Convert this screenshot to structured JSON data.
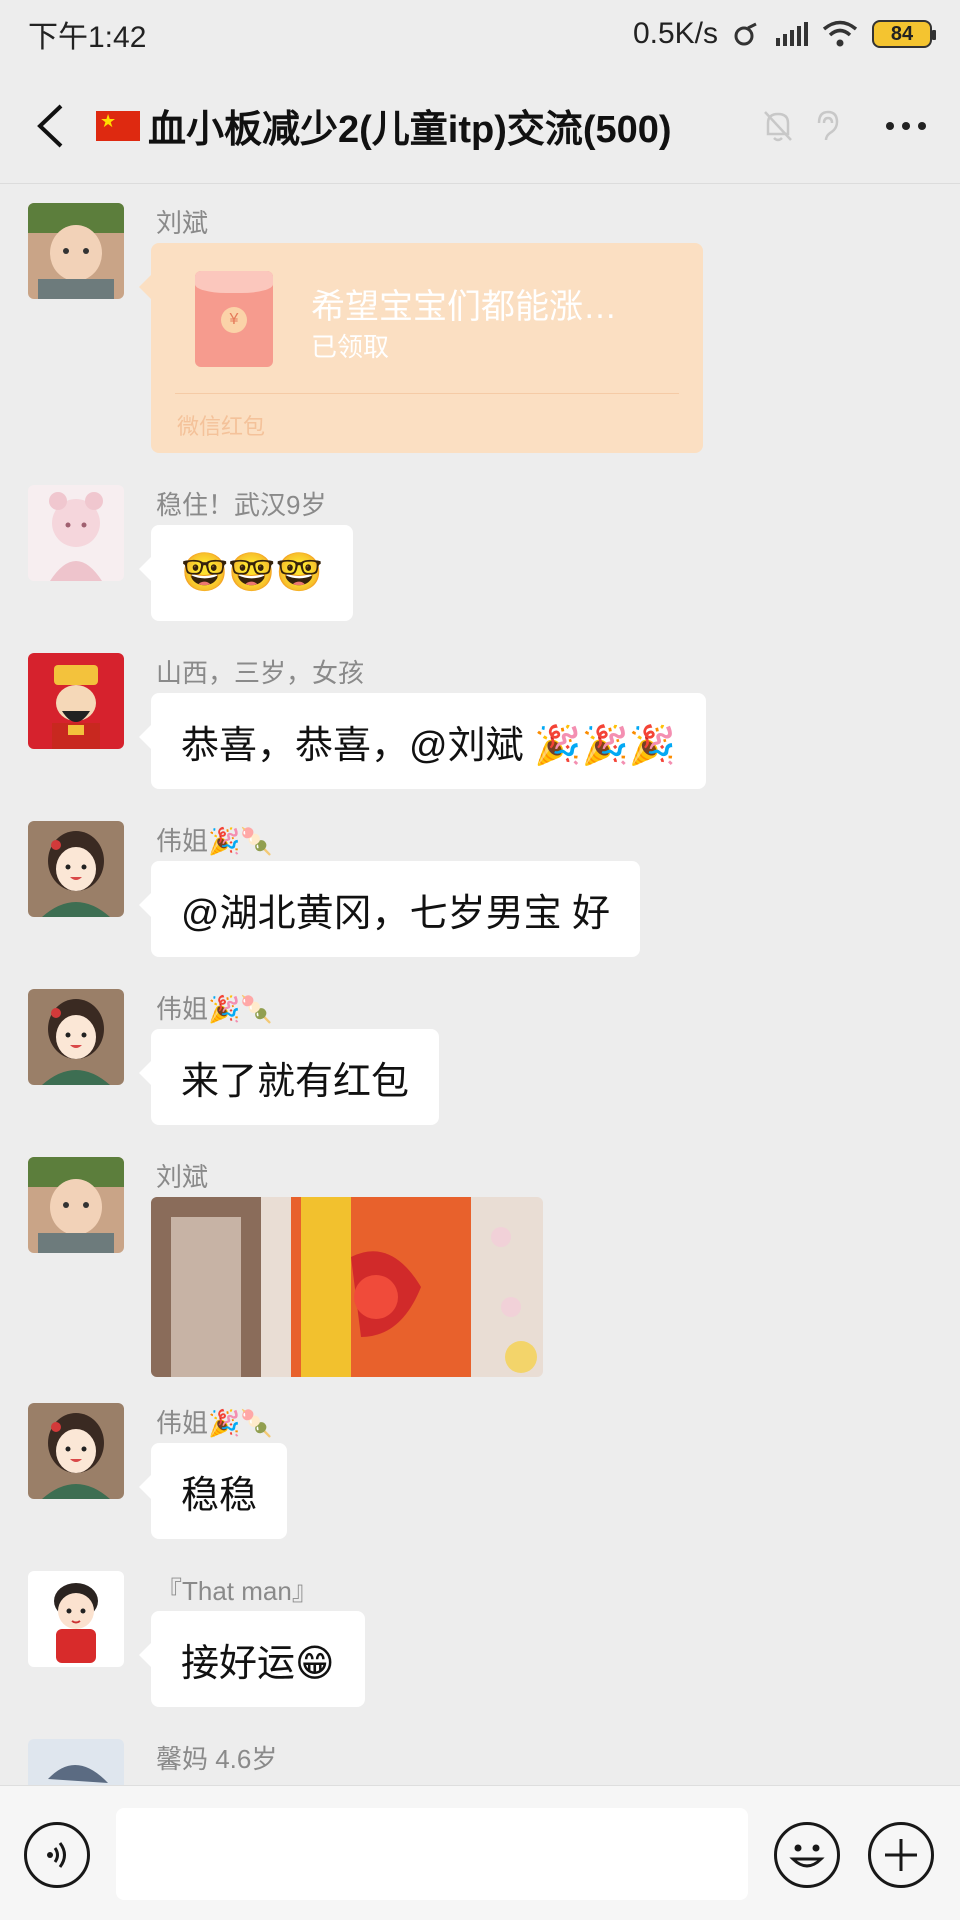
{
  "status_bar": {
    "time": "下午1:42",
    "network_speed": "0.5K/s",
    "battery": "84"
  },
  "header": {
    "title": "血小板减少2(儿童itp)交流(500)",
    "flag_icon": "china-flag-icon",
    "icons": [
      "mute-bell-icon",
      "ear-icon",
      "more-icon"
    ]
  },
  "messages": [
    {
      "sender": "刘斌",
      "type": "red_packet",
      "red_packet": {
        "title": "希望宝宝们都能涨…",
        "status": "已领取",
        "label": "微信红包",
        "coin_symbol": "¥"
      }
    },
    {
      "sender": "稳住！武汉9岁",
      "type": "text",
      "text": "🤓🤓🤓"
    },
    {
      "sender": "山西，三岁，女孩",
      "type": "text",
      "text": "恭喜，恭喜，@刘斌 🎉🎉🎉"
    },
    {
      "sender": "伟姐🎉🍡",
      "type": "text",
      "text": "@湖北黄冈，七岁男宝  好"
    },
    {
      "sender": "伟姐🎉🍡",
      "type": "text",
      "text": "来了就有红包"
    },
    {
      "sender": "刘斌",
      "type": "image",
      "image_desc": "medicine-box-photo"
    },
    {
      "sender": "伟姐🎉🍡",
      "type": "text",
      "text": "稳稳"
    },
    {
      "sender": "『That man』",
      "type": "text",
      "text": "接好运😁"
    },
    {
      "sender": "馨妈 4.6岁",
      "type": "text",
      "text": ""
    }
  ],
  "input_bar": {
    "placeholder": "",
    "icons": [
      "voice-icon",
      "emoji-icon",
      "plus-icon"
    ]
  },
  "colors": {
    "background": "#ededed",
    "red_packet": "#fbdfc2",
    "bubble": "#ffffff",
    "sender_name": "#8a8a8a"
  }
}
